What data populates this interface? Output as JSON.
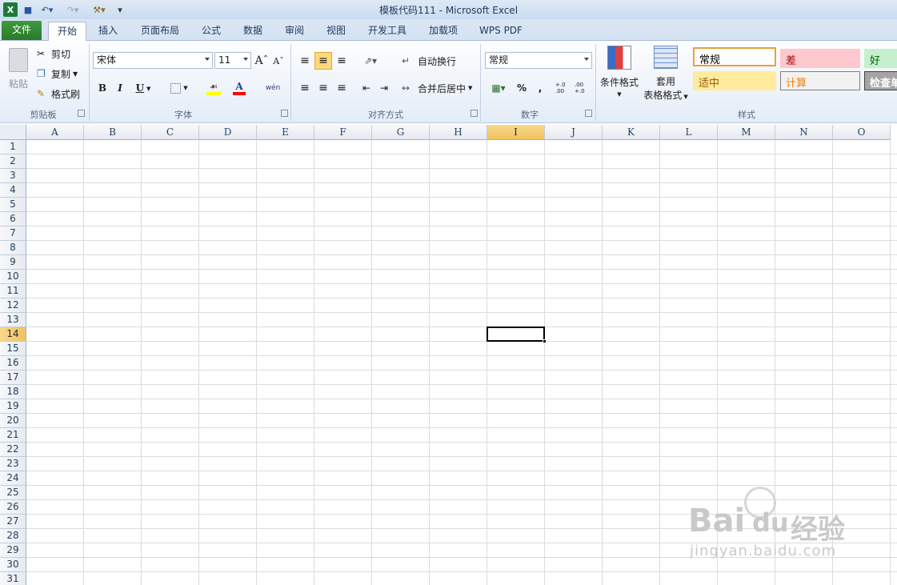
{
  "window": {
    "title": "模板代码111 - Microsoft Excel"
  },
  "qat": {
    "customize_label": "▾"
  },
  "tabs": [
    "文件",
    "开始",
    "插入",
    "页面布局",
    "公式",
    "数据",
    "审阅",
    "视图",
    "开发工具",
    "加载项",
    "WPS PDF"
  ],
  "clipboard": {
    "paste": "粘贴",
    "cut": "剪切",
    "copy": "复制",
    "format_painter": "格式刷",
    "group": "剪贴板"
  },
  "font": {
    "name": "宋体",
    "size": "11",
    "bold": "B",
    "italic": "I",
    "underline": "U",
    "fill_icon": "A",
    "font_color_icon": "A",
    "wen": "wén",
    "group": "字体"
  },
  "alignment": {
    "wrap": "自动换行",
    "merge": "合并后居中",
    "group": "对齐方式"
  },
  "number": {
    "format": "常规",
    "percent": "%",
    "comma": ",",
    "inc_dec": "+.0 .00",
    "dec_dec": ".00 +.0",
    "group": "数字"
  },
  "styles": {
    "conditional": "条件格式",
    "table_format_1": "套用",
    "table_format_2": "表格格式",
    "group": "样式",
    "cells": [
      {
        "label": "常规",
        "bg": "#ffffff",
        "fg": "#000000",
        "border": "#e6a23a"
      },
      {
        "label": "差",
        "bg": "#ffc7ce",
        "fg": "#9c0006",
        "border": "#ffc7ce"
      },
      {
        "label": "好",
        "bg": "#c6efce",
        "fg": "#006100",
        "border": "#c6efce"
      },
      {
        "label": "适中",
        "bg": "#ffeb9c",
        "fg": "#9c5700",
        "border": "#ffeb9c"
      },
      {
        "label": "计算",
        "bg": "#f2f2f2",
        "fg": "#fa7d00",
        "border": "#7f7f7f"
      },
      {
        "label": "检查单",
        "bg": "#a5a5a5",
        "fg": "#ffffff",
        "border": "#3f3f3f"
      }
    ]
  },
  "sheet": {
    "columns": [
      "A",
      "B",
      "C",
      "D",
      "E",
      "F",
      "G",
      "H",
      "I",
      "J",
      "K",
      "L",
      "M",
      "N",
      "O"
    ],
    "rows": [
      "1",
      "2",
      "3",
      "4",
      "5",
      "6",
      "7",
      "8",
      "9",
      "10",
      "11",
      "12",
      "13",
      "14",
      "15",
      "16",
      "17",
      "18",
      "19",
      "20",
      "21",
      "22",
      "23",
      "24",
      "25",
      "26",
      "27",
      "28",
      "29",
      "30",
      "31"
    ],
    "selected_column": "I",
    "selected_row": "14"
  },
  "watermark": {
    "brand": "Bai",
    "brand2": "du",
    "cn": "经验",
    "url": "jingyan.baidu.com"
  }
}
